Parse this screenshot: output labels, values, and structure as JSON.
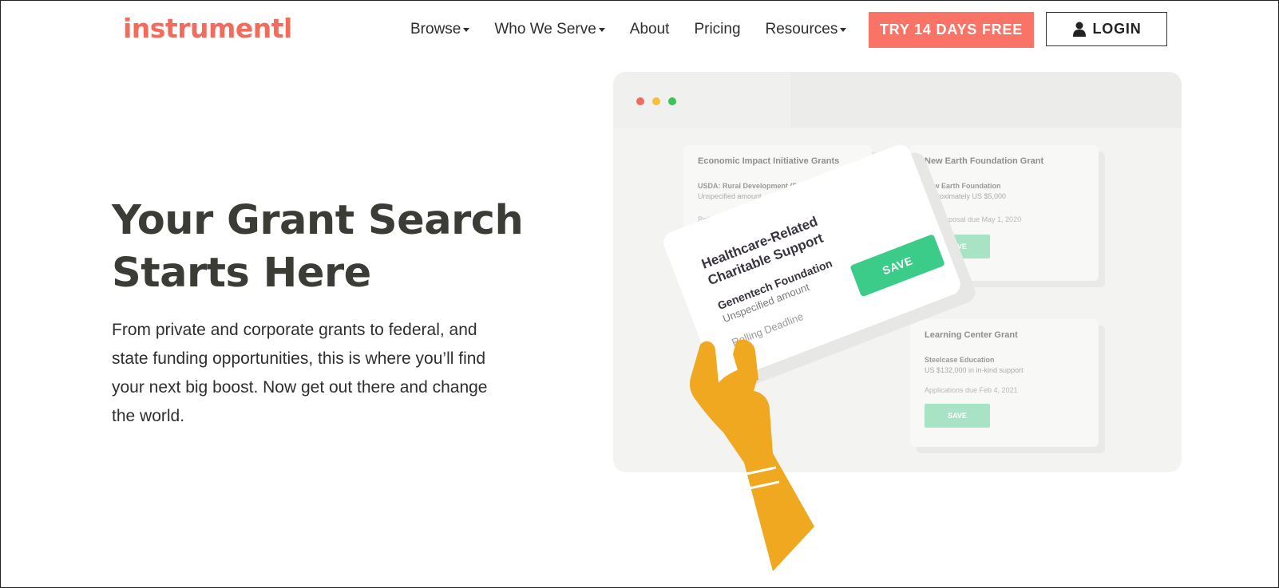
{
  "header": {
    "logo_text": "instrumentl",
    "nav": [
      {
        "label": "Browse",
        "has_dropdown": true
      },
      {
        "label": "Who We Serve",
        "has_dropdown": true
      },
      {
        "label": "About",
        "has_dropdown": false
      },
      {
        "label": "Pricing",
        "has_dropdown": false
      },
      {
        "label": "Resources",
        "has_dropdown": true
      }
    ],
    "trial_button": "TRY 14 DAYS FREE",
    "login_button": "LOGIN"
  },
  "hero": {
    "title": "Your Grant Search Starts Here",
    "body": "From private and corporate grants to federal, and state funding opportunities, this is where you’ll find your next big boost. Now get out there and change the world."
  },
  "illustration": {
    "cards": [
      {
        "title": "Economic Impact Initiative Grants",
        "funder": "USDA: Rural Development (RD)",
        "amount": "Unspecified amount",
        "deadline": "Rolling Deadline",
        "save_label": ""
      },
      {
        "title": "New Earth Foundation Grant",
        "funder": "New Earth Foundation",
        "amount": "Approximately US $5,000",
        "deadline": "Full proposal due May 1, 2020",
        "save_label": "SAVE"
      },
      {
        "title": "Learning Center Grant",
        "funder": "Steelcase Education",
        "amount": "US $132,000 in in-kind support",
        "deadline": "Applications due Feb 4, 2021",
        "save_label": "SAVE"
      }
    ],
    "featured": {
      "title": "Healthcare-Related Charitable Support",
      "funder": "Genentech Foundation",
      "amount": "Unspecified amount",
      "deadline": "Rolling Deadline",
      "save_label": "SAVE"
    }
  },
  "colors": {
    "brand": "#f26c5d",
    "trial_button": "#f97467",
    "save_green": "#3ccc8a",
    "hand": "#f0a820"
  }
}
